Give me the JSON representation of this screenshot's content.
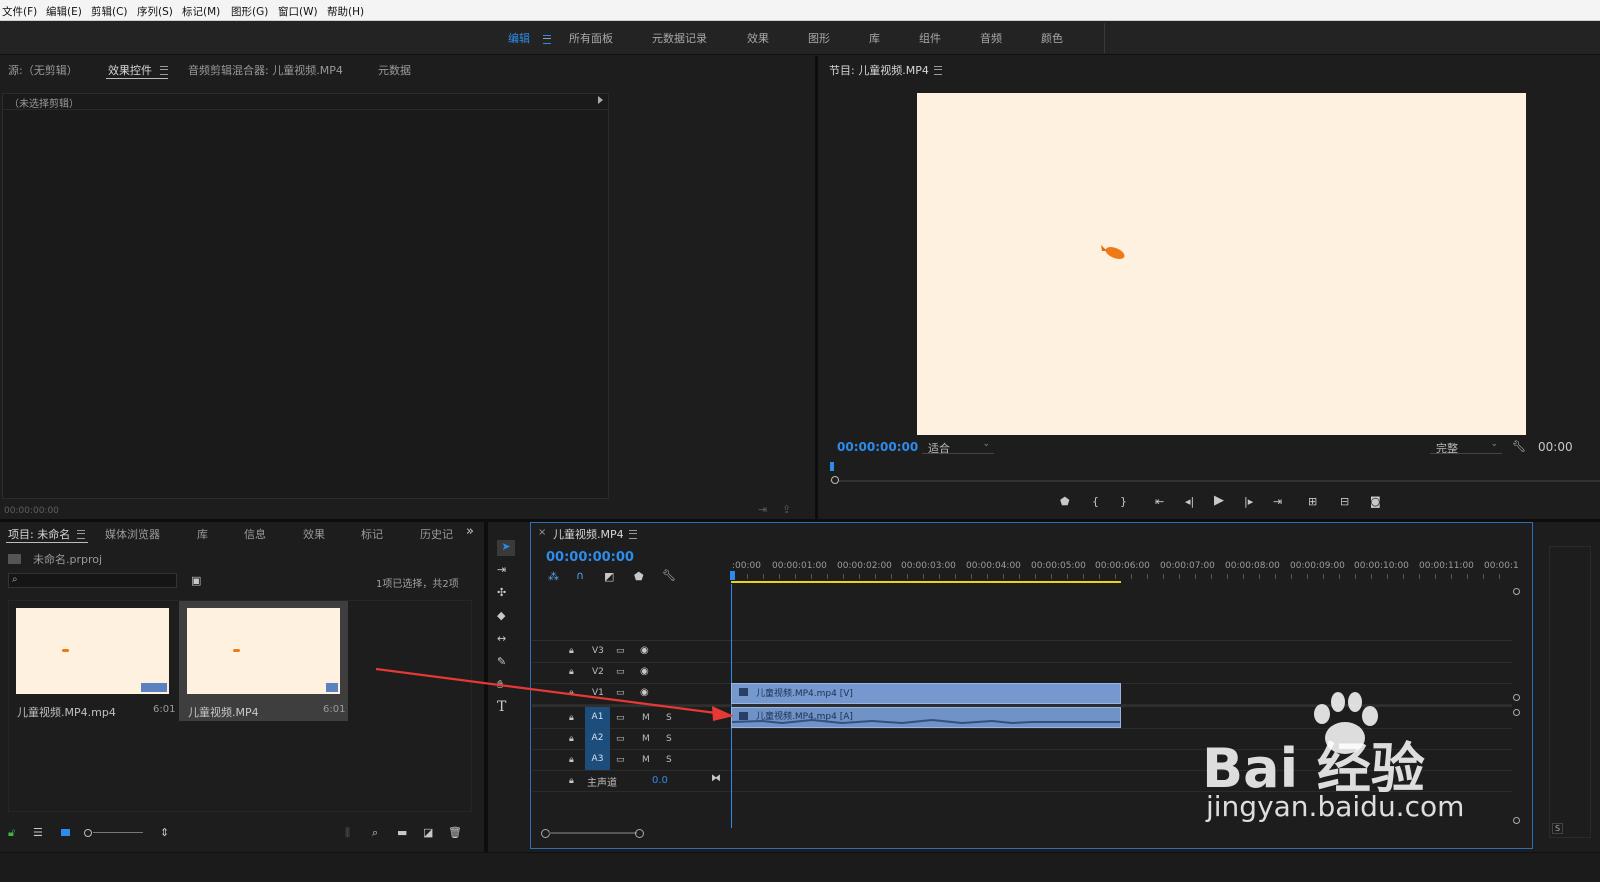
{
  "menu": [
    "文件(F)",
    "编辑(E)",
    "剪辑(C)",
    "序列(S)",
    "标记(M)",
    "图形(G)",
    "窗口(W)",
    "帮助(H)"
  ],
  "workspaces": {
    "active": "编辑",
    "tabs": [
      "所有面板",
      "元数据记录",
      "效果",
      "图形",
      "库",
      "组件",
      "音频",
      "颜色"
    ]
  },
  "source_panel": {
    "tabs": [
      "源:（无剪辑）",
      "效果控件",
      "音频剪辑混合器: 儿童视频.MP4",
      "元数据"
    ],
    "active_tab": "效果控件",
    "no_clip": "（未选择剪辑）",
    "timecode": "00:00:00:00"
  },
  "program_panel": {
    "title": "节目: 儿童视频.MP4",
    "timecode": "00:00:00:00",
    "fit": "适合",
    "quality": "完整",
    "right_timecode": "00:00"
  },
  "project_panel": {
    "tabs": [
      "项目: 未命名",
      "媒体浏览器",
      "库",
      "信息",
      "效果",
      "标记",
      "历史记"
    ],
    "file": "未命名.prproj",
    "selection_status": "1项已选择，共2项",
    "items": [
      {
        "name": "儿童视频.MP4.mp4",
        "duration": "6:01",
        "selected": false
      },
      {
        "name": "儿童视频.MP4",
        "duration": "6:01",
        "selected": true
      }
    ]
  },
  "timeline": {
    "title": "儿童视频.MP4",
    "timecode": "00:00:00:00",
    "ruler": [
      ":00:00",
      "00:00:01:00",
      "00:00:02:00",
      "00:00:03:00",
      "00:00:04:00",
      "00:00:05:00",
      "00:00:06:00",
      "00:00:07:00",
      "00:00:08:00",
      "00:00:09:00",
      "00:00:10:00",
      "00:00:11:00",
      "00:00:1"
    ],
    "video_tracks": [
      "V3",
      "V2",
      "V1"
    ],
    "audio_tracks": [
      "A1",
      "A2",
      "A3"
    ],
    "mute_label": "M",
    "solo_label": "S",
    "master_label": "主声道",
    "master_value": "0.0",
    "video_clip": "儿童视频.MP4.mp4 [V]",
    "audio_clip": "儿童视频.MP4.mp4 [A]"
  },
  "watermark": {
    "brand": "Bai 经验",
    "url": "jingyan.baidu.com"
  },
  "colors": {
    "accent": "#2d8ceb",
    "clip": "#7599cf",
    "frame": "#fff1df",
    "arrow": "#e53935"
  }
}
